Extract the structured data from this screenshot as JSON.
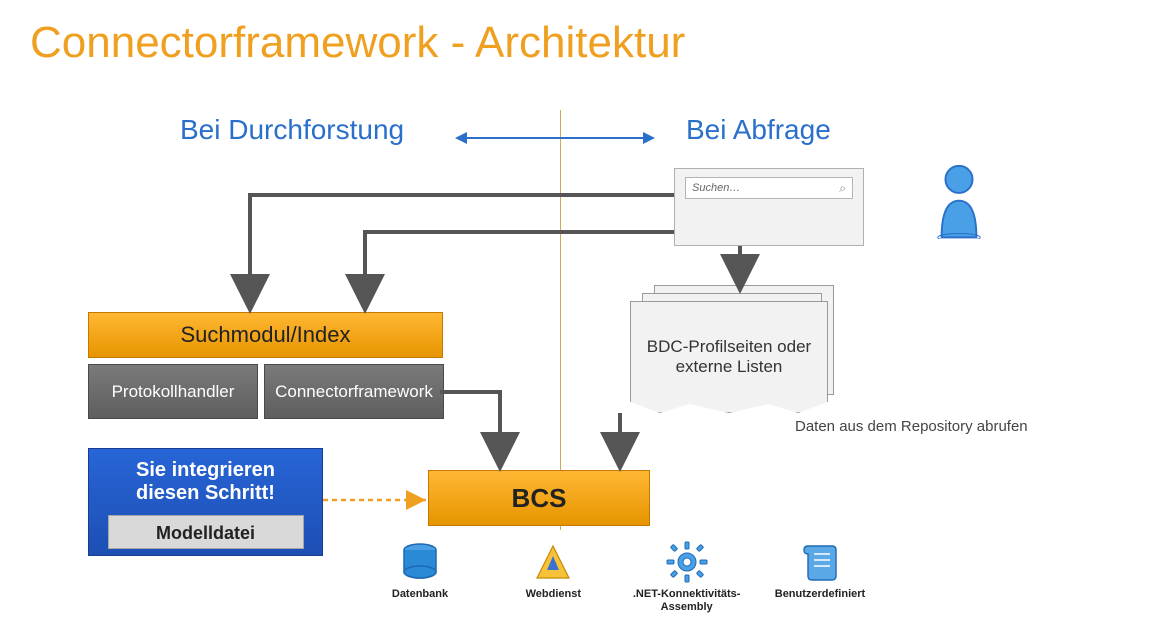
{
  "title": "Connectorframework - Architektur",
  "subtitles": {
    "crawl": "Bei Durchforstung",
    "query": "Bei Abfrage"
  },
  "search_placeholder": "Suchen…",
  "search_module": "Suchmodul/Index",
  "protocol_handler": "Protokollhandler",
  "connector_framework": "Connectorframework",
  "bdc_pages_line1": "BDC-Profilseiten oder",
  "bdc_pages_line2": "externe Listen",
  "repo_note": "Daten aus dem Repository abrufen",
  "integrate_line1": "Sie integrieren",
  "integrate_line2": "diesen Schritt!",
  "model_file": "Modelldatei",
  "bcs": "BCS",
  "icons": {
    "database": "Datenbank",
    "webservice": "Webdienst",
    "dotnet": ".NET-Konnektivitäts-Assembly",
    "custom": "Benutzerdefiniert"
  },
  "colors": {
    "title": "#f0a020",
    "subtitle_blue": "#2a6fc9",
    "orange_grad_top": "#ffb733",
    "orange_grad_bot": "#e69500",
    "gray_grad_top": "#7a7a7a",
    "gray_grad_bot": "#5e5e5e",
    "blue_grad_top": "#2765d6",
    "blue_grad_bot": "#1d4fb4",
    "arrow": "#555555",
    "icon_blue": "#2a8ad6"
  }
}
